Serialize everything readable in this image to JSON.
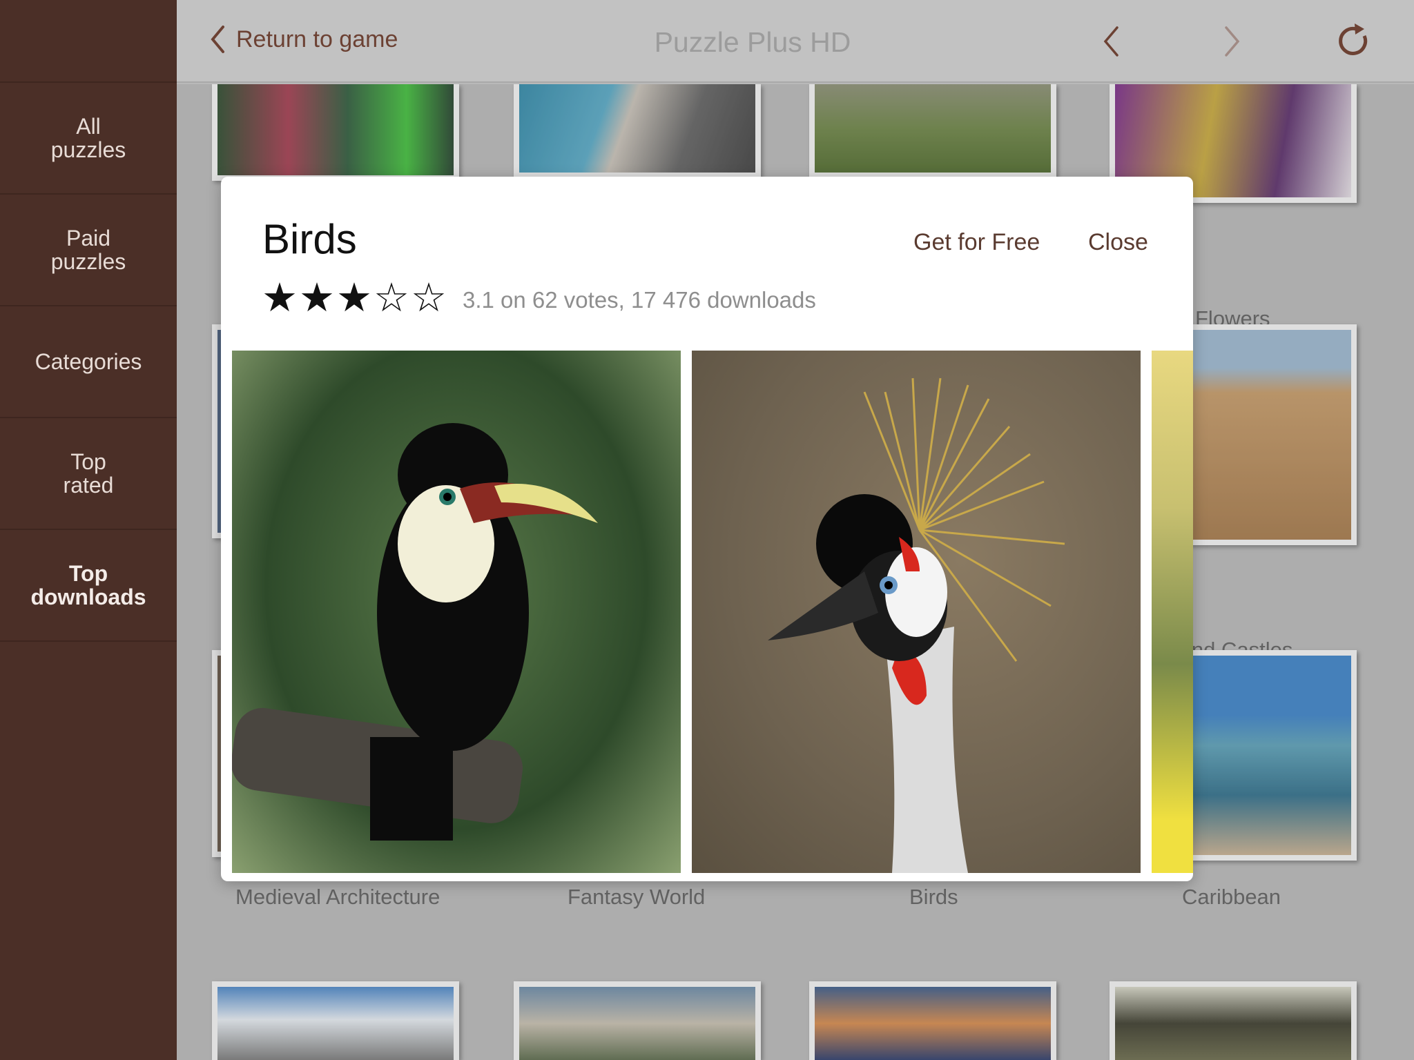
{
  "sidebar": {
    "items": [
      {
        "label": "All\npuzzles",
        "active": false
      },
      {
        "label": "Paid\npuzzles",
        "active": false
      },
      {
        "label": "Categories",
        "active": false
      },
      {
        "label": "Top\nrated",
        "active": false
      },
      {
        "label": "Top\ndownloads",
        "active": true
      }
    ]
  },
  "header": {
    "back_label": "Return to game",
    "title": "Puzzle Plus HD",
    "icons": [
      "chevron-left-icon",
      "chevron-left-icon",
      "chevron-right-icon",
      "refresh-icon"
    ]
  },
  "grid": {
    "labels": [
      "Flowers",
      "Sand Castles",
      "Medieval Architecture",
      "Fantasy World",
      "Birds",
      "Caribbean"
    ]
  },
  "modal": {
    "title": "Birds",
    "get_label": "Get for Free",
    "close_label": "Close",
    "rating": 3.1,
    "max_rating": 5,
    "rating_text": "3.1 on 62 votes, 17 476 downloads",
    "images": [
      "toucan",
      "crowned crane",
      "flowers"
    ]
  },
  "colors": {
    "sidebar": "#4b2f27",
    "accent": "#6c4133"
  }
}
